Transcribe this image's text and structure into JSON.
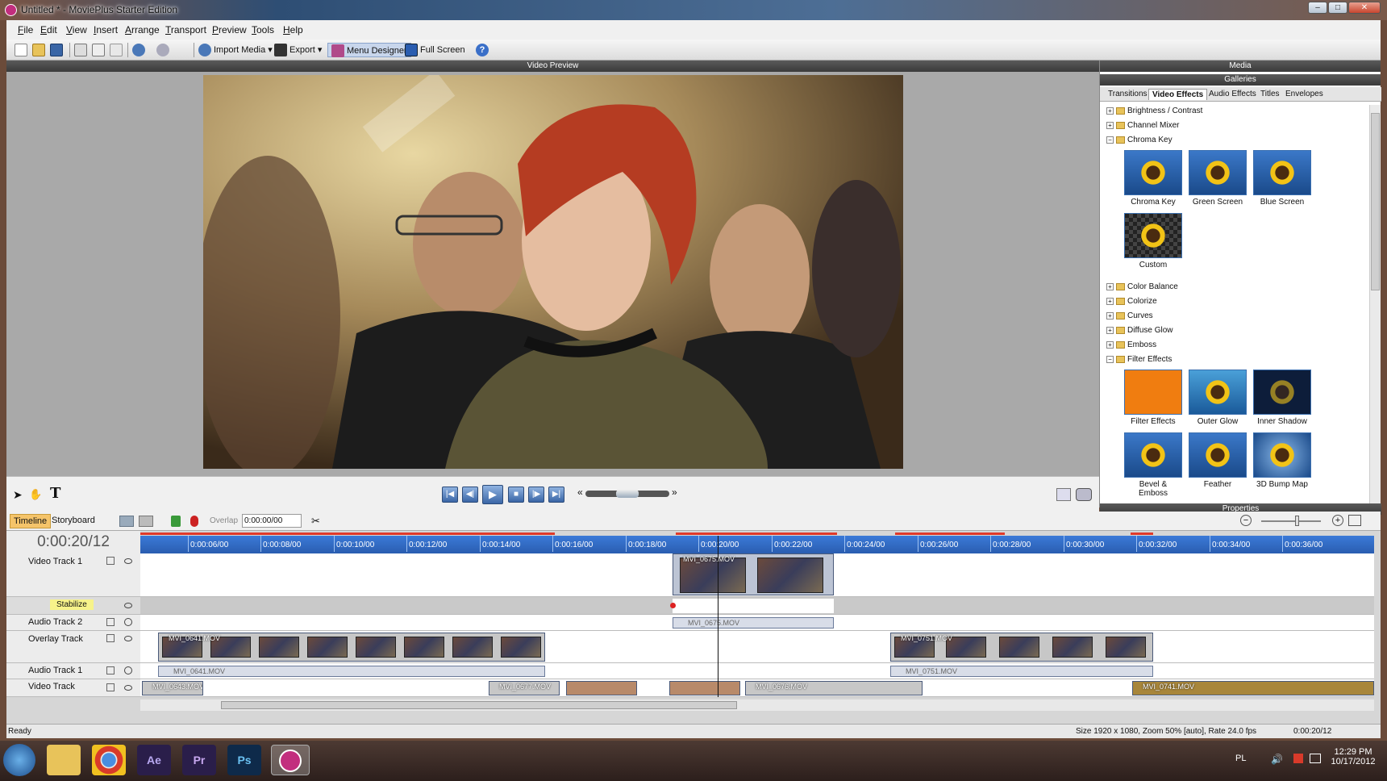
{
  "window": {
    "title": "Untitled * - MoviePlus Starter Edition",
    "min": "–",
    "max": "□",
    "close": "✕"
  },
  "menu": [
    {
      "first": "F",
      "rest": "ile"
    },
    {
      "first": "E",
      "rest": "dit"
    },
    {
      "first": "V",
      "rest": "iew"
    },
    {
      "first": "I",
      "rest": "nsert"
    },
    {
      "first": "A",
      "rest": "rrange"
    },
    {
      "first": "T",
      "rest": "ransport"
    },
    {
      "first": "P",
      "rest": "review"
    },
    {
      "first": "T",
      "rest": "ools"
    },
    {
      "first": "H",
      "rest": "elp"
    }
  ],
  "toolbar": {
    "import": "Import Media",
    "export": "Export",
    "menu_designer": "Menu Designer",
    "full_screen": "Full Screen",
    "help": "?",
    "dropdown": "▾"
  },
  "preview": {
    "header": "Video Preview"
  },
  "transport": {
    "first": "|◀",
    "prev": "◀|",
    "play": "▶",
    "stop": "■",
    "next": "|▶",
    "last": "▶|",
    "rew": "«",
    "ff": "»"
  },
  "media": {
    "header": "Media",
    "galleries": "Galleries",
    "tabs": [
      "Transitions",
      "Video Effects",
      "Audio Effects",
      "Titles",
      "Envelopes"
    ],
    "tree": [
      {
        "label": "Brightness / Contrast",
        "pm": "+"
      },
      {
        "label": "Channel Mixer",
        "pm": "+"
      },
      {
        "label": "Chroma Key",
        "pm": "−"
      },
      {
        "label": "Color Balance",
        "pm": "+"
      },
      {
        "label": "Colorize",
        "pm": "+"
      },
      {
        "label": "Curves",
        "pm": "+"
      },
      {
        "label": "Diffuse Glow",
        "pm": "+"
      },
      {
        "label": "Emboss",
        "pm": "+"
      },
      {
        "label": "Filter Effects",
        "pm": "−"
      }
    ],
    "chroma_thumbs": [
      "Chroma Key",
      "Green Screen",
      "Blue Screen",
      "Custom"
    ],
    "filter_thumbs": [
      "Filter Effects",
      "Outer Glow",
      "Inner Shadow",
      "Bevel & Emboss",
      "Feather",
      "3D Bump Map"
    ],
    "properties": "Properties"
  },
  "timeline": {
    "tabs": [
      "Timeline",
      "Storyboard"
    ],
    "overlap_label": "Overlap",
    "overlap_value": "0:00:00/00",
    "timecode": "0:00:20/12",
    "ruler": [
      "0:00:06/00",
      "0:00:08/00",
      "0:00:10/00",
      "0:00:12/00",
      "0:00:14/00",
      "0:00:16/00",
      "0:00:18/00",
      "0:00:20/00",
      "0:00:22/00",
      "0:00:24/00",
      "0:00:26/00",
      "0:00:28/00",
      "0:00:30/00",
      "0:00:32/00",
      "0:00:34/00",
      "0:00:36/00"
    ],
    "tracks": {
      "video1": "Video Track 1",
      "stabilize": "Stabilize",
      "audio2": "Audio Track 2",
      "overlay": "Overlay Track",
      "audio1": "Audio Track 1",
      "video": "Video Track"
    },
    "clips": {
      "v1": "MVI_0675.MOV",
      "a2": "MVI_0675.MOV",
      "ov1": "MVI_0641.MOV",
      "ov2": "MVI_0751.MOV",
      "a1a": "MVI_0641.MOV",
      "a1b": "MVI_0751.MOV",
      "vt1": "MVI_0643.MOV",
      "vt2": "MVI_0677.MOV",
      "vt3": "MVI_0676.MOV",
      "vt4": "MVI_0741.MOV"
    }
  },
  "status": {
    "left": "Ready",
    "info": "Size 1920 x 1080, Zoom 50% [auto], Rate 24.0 fps",
    "time": "0:00:20/12"
  },
  "taskbar": {
    "lang": "PL",
    "time": "12:29 PM",
    "date": "10/17/2012",
    "ae": "Ae",
    "pr": "Pr",
    "ps": "Ps"
  }
}
